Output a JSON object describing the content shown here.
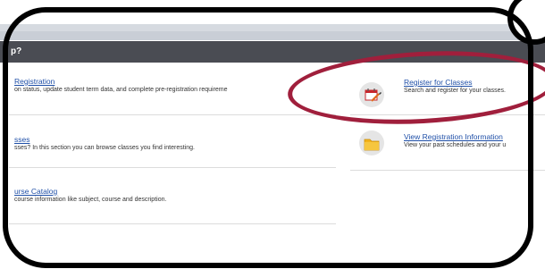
{
  "header": {
    "title": "p?"
  },
  "cards": {
    "registration": {
      "title": "Registration",
      "desc": "on status, update student term data, and complete pre-registration requireme"
    },
    "classes": {
      "title": "sses",
      "desc": "sses? In this section you can browse classes you find interesting."
    },
    "catalog": {
      "title": "urse Catalog",
      "desc": "course information like subject, course and description."
    },
    "register_classes": {
      "title": "Register for Classes",
      "desc": "Search and register for your classes."
    },
    "view_info": {
      "title": "View Registration Information",
      "desc": "View your past schedules and your u"
    }
  },
  "colors": {
    "annotation": "#a01f3c",
    "header_bg": "#4a4c53",
    "link": "#2050a8"
  },
  "icons": {
    "register": "calendar-pencil-icon",
    "view": "folder-icon"
  }
}
